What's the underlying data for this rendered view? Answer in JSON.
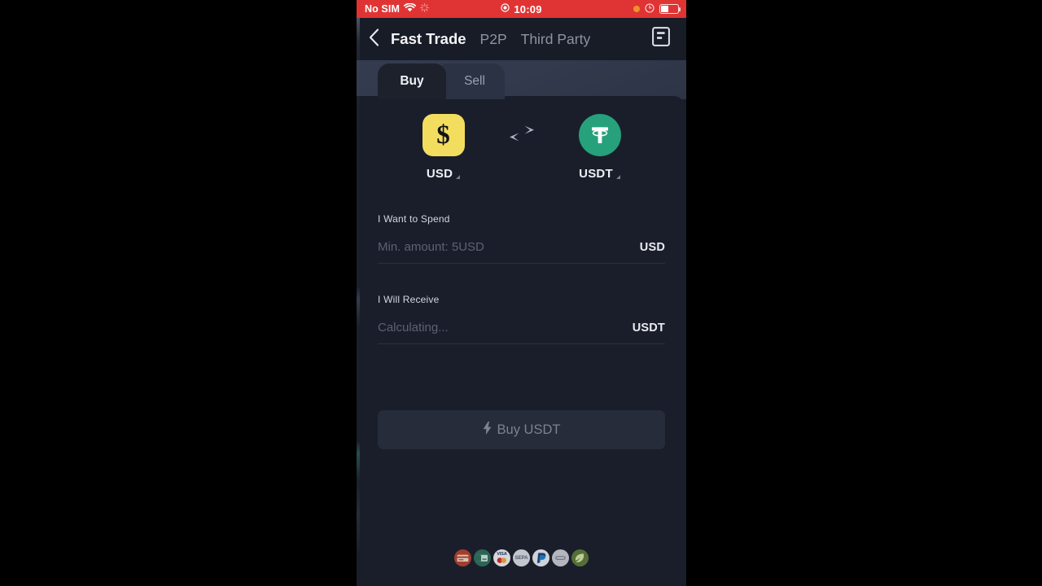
{
  "status_bar": {
    "carrier": "No SIM",
    "wifi_icon": "wifi-icon",
    "spark_icon": "spark-icon",
    "record_icon": "record-dot-icon",
    "time": "10:09",
    "orange_dot_icon": "orange-dot-icon",
    "rotation_lock_icon": "rotation-lock-icon",
    "battery_icon": "battery-icon",
    "background_color": "#e03434"
  },
  "nav": {
    "back_icon": "back-chevron-icon",
    "tabs": [
      {
        "label": "Fast Trade",
        "active": true
      },
      {
        "label": "P2P",
        "active": false
      },
      {
        "label": "Third Party",
        "active": false
      }
    ],
    "orders_icon": "orders-document-icon"
  },
  "segmented_tabs": [
    {
      "label": "Buy",
      "active": true
    },
    {
      "label": "Sell",
      "active": false
    }
  ],
  "pair": {
    "from": {
      "symbol": "USD",
      "icon": "usd-dollar-icon",
      "glyph": "$",
      "color": "#f3dd5e",
      "dropdown_icon": "caret-down-icon"
    },
    "swap_icon": "swap-arrows-icon",
    "to": {
      "symbol": "USDT",
      "icon": "tether-usdt-icon",
      "color": "#26a17b",
      "dropdown_icon": "caret-down-icon"
    }
  },
  "spend_field": {
    "label": "I Want to Spend",
    "value": "",
    "placeholder": "Min. amount: 5USD",
    "suffix": "USD"
  },
  "receive_field": {
    "label": "I Will Receive",
    "value": "Calculating...",
    "suffix": "USDT"
  },
  "buy_button": {
    "label": "Buy USDT",
    "icon": "lightning-bolt-icon",
    "enabled": false
  },
  "payment_methods": [
    {
      "name": "credit-card",
      "label": "",
      "bg": "#b5422f",
      "fg": "#f0d8c0"
    },
    {
      "name": "green-card",
      "label": "",
      "bg": "#2f6f5c",
      "fg": "#cfe8de"
    },
    {
      "name": "visa-mastercard",
      "label": "VISA",
      "bg": "#f0f1f4",
      "fg": "#20306a"
    },
    {
      "name": "sepa",
      "label": "SEPA",
      "bg": "#dcdee4",
      "fg": "#5d6472"
    },
    {
      "name": "paypal",
      "label": "P",
      "bg": "#e9ebf0",
      "fg": "#1d3a80"
    },
    {
      "name": "generic-card",
      "label": "",
      "bg": "#c9ccd4",
      "fg": "#606676"
    },
    {
      "name": "green-leaf",
      "label": "",
      "bg": "#5e7a3a",
      "fg": "#d6e6a8"
    }
  ],
  "colors": {
    "panel_bg": "#1a1e2a",
    "screen_bg": "#181c26",
    "tab_band": "#333a4d",
    "divider": "#2a3040",
    "muted_text": "#5b6273"
  }
}
